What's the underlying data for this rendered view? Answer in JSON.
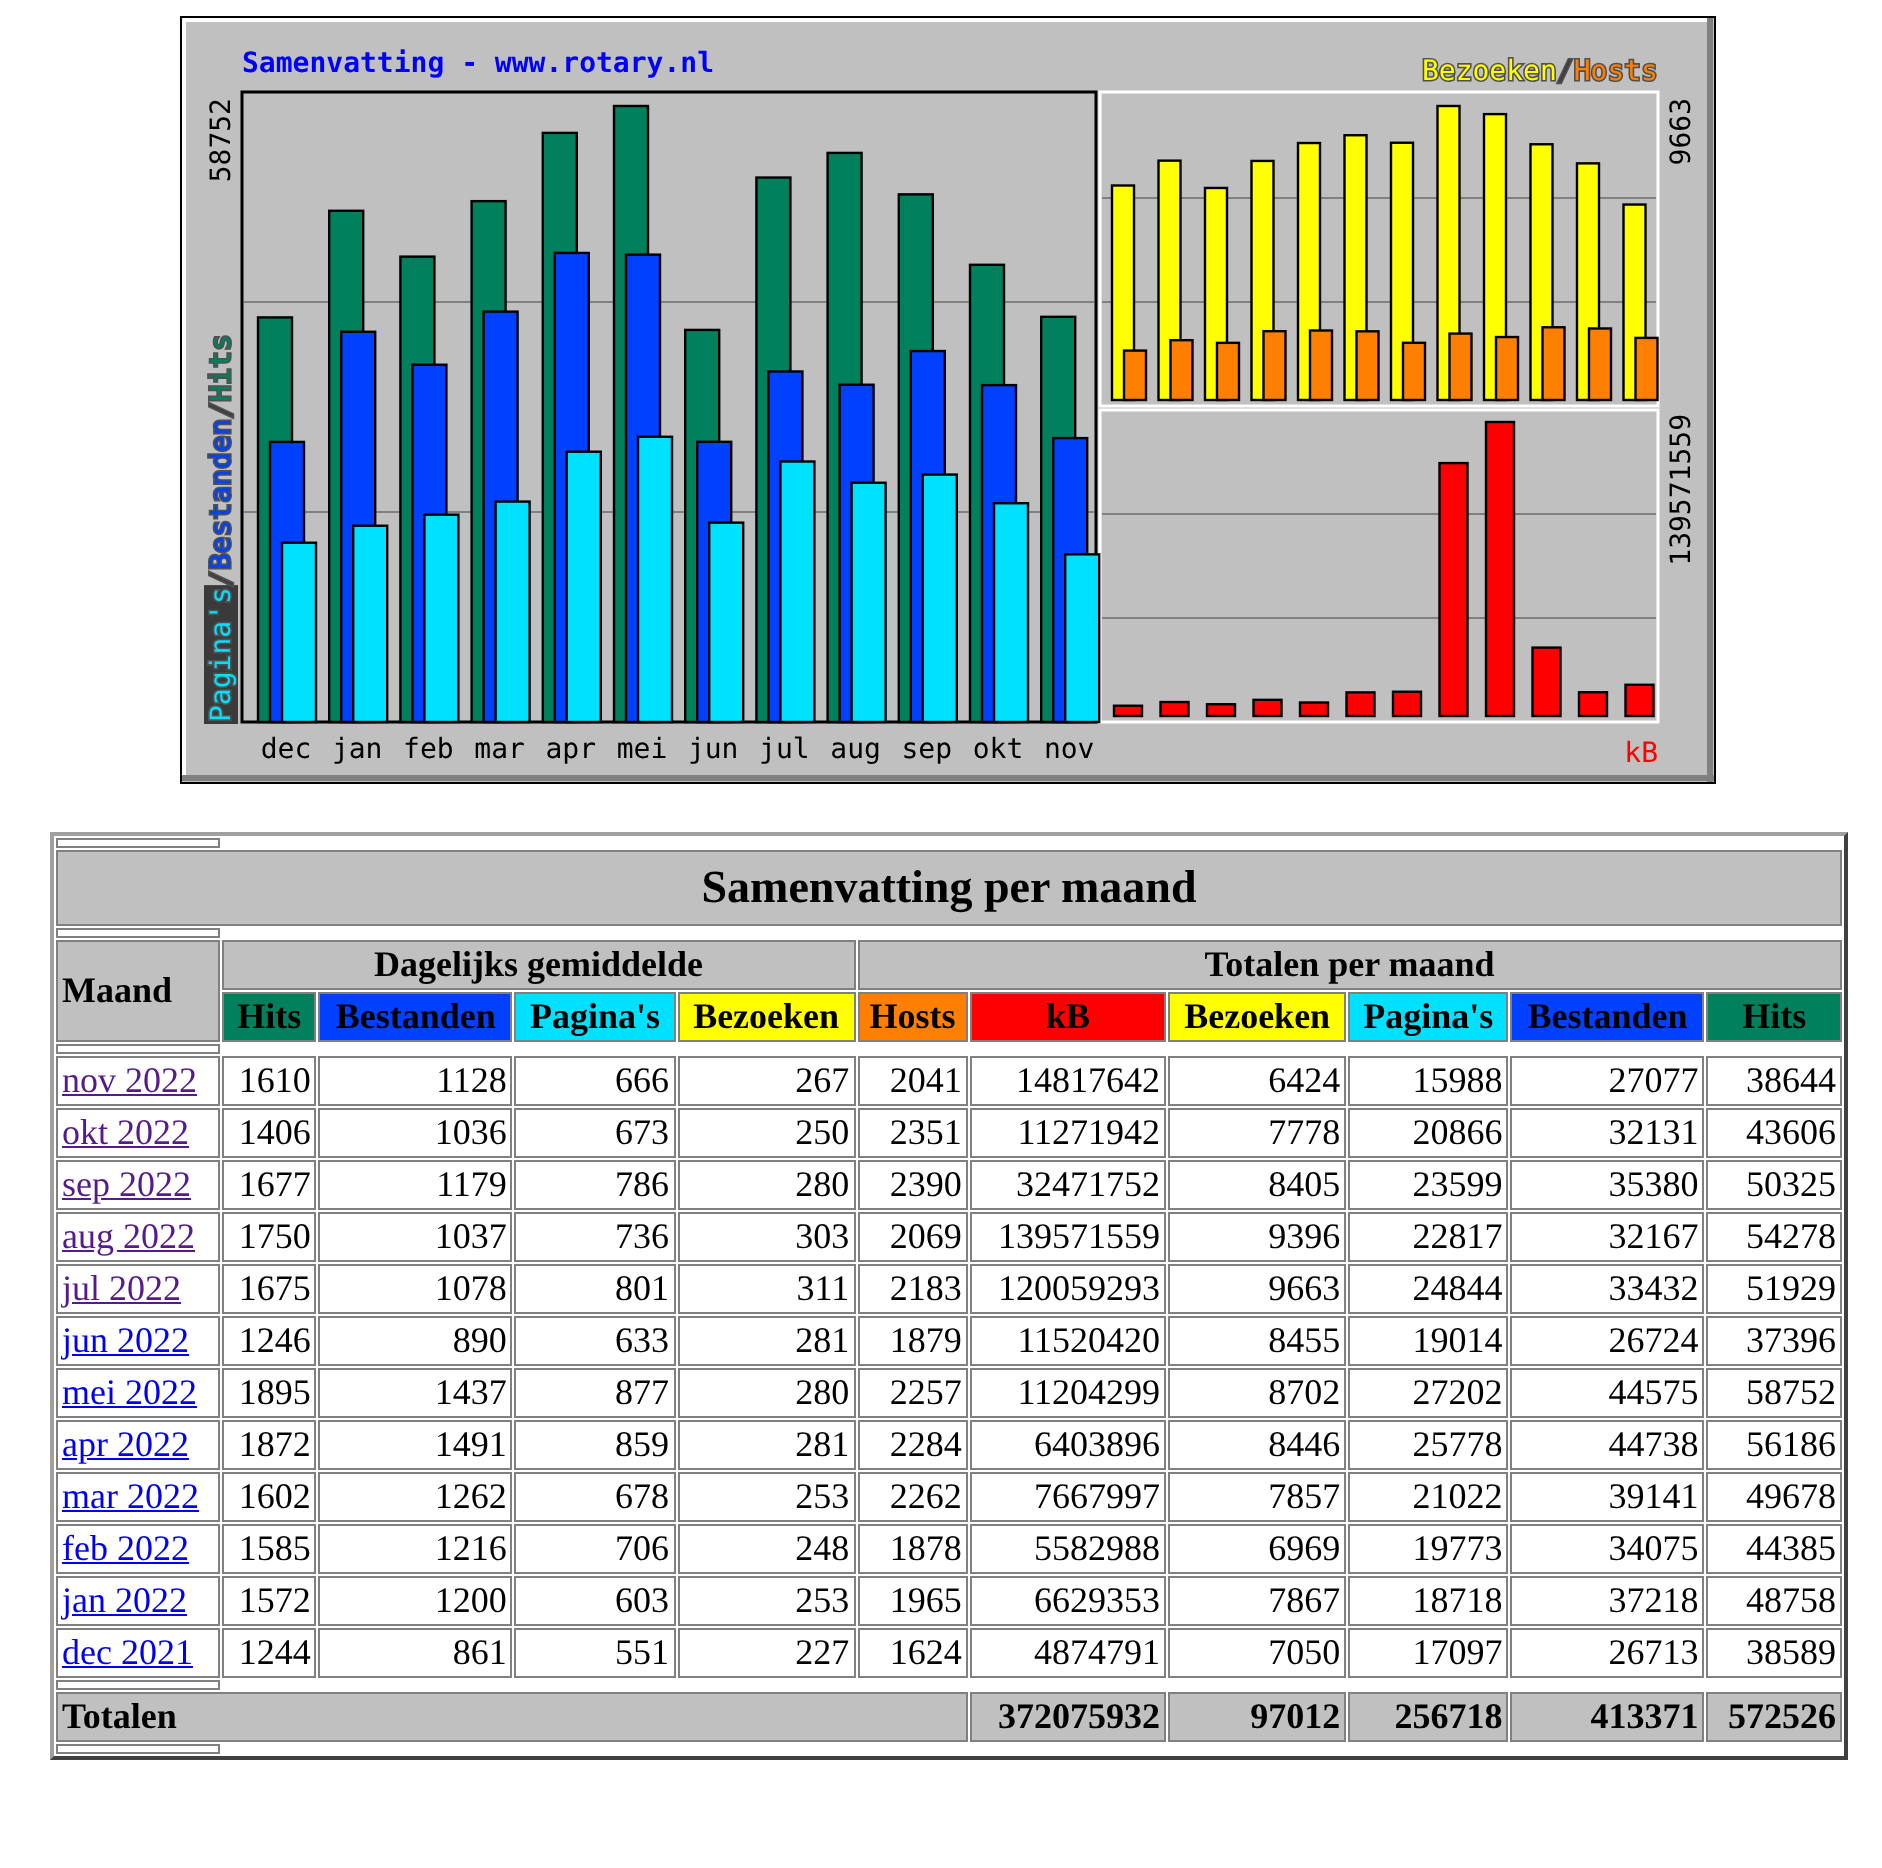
{
  "chart": {
    "title": "Samenvatting - www.rotary.nl",
    "legend_left": [
      {
        "label": "Pagina's",
        "color": "#00e0ff",
        "sep": "/"
      },
      {
        "label": "Bestanden",
        "color": "#0040ff",
        "sep": "/"
      },
      {
        "label": "Hits",
        "color": "#00805c"
      }
    ],
    "legend_right": [
      {
        "label": "Bezoeken",
        "color": "#ffff00",
        "sep": "/"
      },
      {
        "label": "Hosts",
        "color": "#ff8000"
      }
    ],
    "kb_label": {
      "label": "kB",
      "color": "#ff0000"
    },
    "max_hits": "58752",
    "max_visits": "9663",
    "max_kb": "139571559",
    "months": [
      "dec",
      "jan",
      "feb",
      "mar",
      "apr",
      "mei",
      "jun",
      "jul",
      "aug",
      "sep",
      "okt",
      "nov"
    ]
  },
  "table": {
    "title": "Samenvatting per maand",
    "month_header": "Maand",
    "daily_header": "Dagelijks gemiddelde",
    "totals_header": "Totalen per maand",
    "daily_columns": [
      {
        "label": "Hits",
        "color": "#00805c"
      },
      {
        "label": "Bestanden",
        "color": "#0040ff"
      },
      {
        "label": "Pagina's",
        "color": "#00e0ff"
      },
      {
        "label": "Bezoeken",
        "color": "#ffff00"
      }
    ],
    "total_columns": [
      {
        "label": "Hosts",
        "color": "#ff8000"
      },
      {
        "label": "kB",
        "color": "#ff0000"
      },
      {
        "label": "Bezoeken",
        "color": "#ffff00"
      },
      {
        "label": "Pagina's",
        "color": "#00e0ff"
      },
      {
        "label": "Bestanden",
        "color": "#0040ff"
      },
      {
        "label": "Hits",
        "color": "#00805c"
      }
    ],
    "rows": [
      {
        "month": "nov 2022",
        "visited": true,
        "daily": [
          "1610",
          "1128",
          "666",
          "267"
        ],
        "totals": [
          "2041",
          "14817642",
          "6424",
          "15988",
          "27077",
          "38644"
        ]
      },
      {
        "month": "okt 2022",
        "visited": true,
        "daily": [
          "1406",
          "1036",
          "673",
          "250"
        ],
        "totals": [
          "2351",
          "11271942",
          "7778",
          "20866",
          "32131",
          "43606"
        ]
      },
      {
        "month": "sep 2022",
        "visited": true,
        "daily": [
          "1677",
          "1179",
          "786",
          "280"
        ],
        "totals": [
          "2390",
          "32471752",
          "8405",
          "23599",
          "35380",
          "50325"
        ]
      },
      {
        "month": "aug 2022",
        "visited": true,
        "daily": [
          "1750",
          "1037",
          "736",
          "303"
        ],
        "totals": [
          "2069",
          "139571559",
          "9396",
          "22817",
          "32167",
          "54278"
        ]
      },
      {
        "month": "jul 2022",
        "visited": true,
        "daily": [
          "1675",
          "1078",
          "801",
          "311"
        ],
        "totals": [
          "2183",
          "120059293",
          "9663",
          "24844",
          "33432",
          "51929"
        ]
      },
      {
        "month": "jun 2022",
        "visited": false,
        "daily": [
          "1246",
          "890",
          "633",
          "281"
        ],
        "totals": [
          "1879",
          "11520420",
          "8455",
          "19014",
          "26724",
          "37396"
        ]
      },
      {
        "month": "mei 2022",
        "visited": false,
        "daily": [
          "1895",
          "1437",
          "877",
          "280"
        ],
        "totals": [
          "2257",
          "11204299",
          "8702",
          "27202",
          "44575",
          "58752"
        ]
      },
      {
        "month": "apr 2022",
        "visited": false,
        "daily": [
          "1872",
          "1491",
          "859",
          "281"
        ],
        "totals": [
          "2284",
          "6403896",
          "8446",
          "25778",
          "44738",
          "56186"
        ]
      },
      {
        "month": "mar 2022",
        "visited": false,
        "daily": [
          "1602",
          "1262",
          "678",
          "253"
        ],
        "totals": [
          "2262",
          "7667997",
          "7857",
          "21022",
          "39141",
          "49678"
        ]
      },
      {
        "month": "feb 2022",
        "visited": false,
        "daily": [
          "1585",
          "1216",
          "706",
          "248"
        ],
        "totals": [
          "1878",
          "5582988",
          "6969",
          "19773",
          "34075",
          "44385"
        ]
      },
      {
        "month": "jan 2022",
        "visited": false,
        "daily": [
          "1572",
          "1200",
          "603",
          "253"
        ],
        "totals": [
          "1965",
          "6629353",
          "7867",
          "18718",
          "37218",
          "48758"
        ]
      },
      {
        "month": "dec 2021",
        "visited": false,
        "daily": [
          "1244",
          "861",
          "551",
          "227"
        ],
        "totals": [
          "1624",
          "4874791",
          "7050",
          "17097",
          "26713",
          "38589"
        ]
      }
    ],
    "total_row": {
      "label": "Totalen",
      "values": [
        "372075932",
        "97012",
        "256718",
        "413371",
        "572526"
      ]
    }
  }
}
